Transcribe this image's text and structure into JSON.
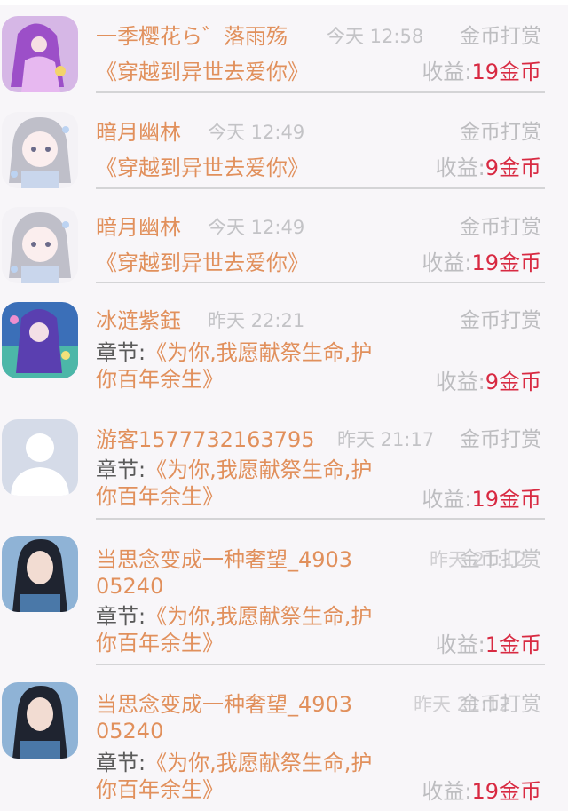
{
  "rows": [
    {
      "name": "一季樱花ら゛落雨殇",
      "time": "今天 12:58",
      "type": "金币打赏",
      "book_prefix": "",
      "book": "《穿越到异世去爱你》",
      "earn_label": "收益:",
      "earn_value": "19金币",
      "avatar": "purple-fairy-avatar"
    },
    {
      "name": "暗月幽林",
      "time": "今天 12:49",
      "type": "金币打赏",
      "book_prefix": "",
      "book": "《穿越到异世去爱你》",
      "earn_label": "收益:",
      "earn_value": "9金币",
      "avatar": "chibi-girl-avatar"
    },
    {
      "name": "暗月幽林",
      "time": "今天 12:49",
      "type": "金币打赏",
      "book_prefix": "",
      "book": "《穿越到异世去爱你》",
      "earn_label": "收益:",
      "earn_value": "19金币",
      "avatar": "chibi-girl-avatar"
    },
    {
      "name": "冰涟紫鈺",
      "time": "昨天 22:21",
      "type": "金币打赏",
      "book_prefix": "章节:",
      "book": "《为你,我愿献祭生命,护你百年余生》",
      "earn_label": "收益:",
      "earn_value": "9金币",
      "avatar": "blue-anime-girl-avatar"
    },
    {
      "name": "游客1577732163795",
      "time": "昨天 21:17",
      "type": "金币打赏",
      "book_prefix": "章节:",
      "book": "《为你,我愿献祭生命,护你百年余生》",
      "earn_label": "收益:",
      "earn_value": "19金币",
      "avatar": "default-user-avatar"
    },
    {
      "name": "当思念变成一种奢望_490305240",
      "time": "昨天 21:12",
      "type": "金币打赏",
      "book_prefix": "章节:",
      "book": "《为你,我愿献祭生命,护你百年余生》",
      "earn_label": "收益:",
      "earn_value": "1金币",
      "avatar": "photo-girl-avatar"
    },
    {
      "name": "当思念变成一种奢望_490305240",
      "time": "昨天 21:12",
      "type": "金币打赏",
      "book_prefix": "章节:",
      "book": "《为你,我愿献祭生命,护你百年余生》",
      "earn_label": "收益:",
      "earn_value": "19金币",
      "avatar": "photo-girl-avatar"
    }
  ]
}
